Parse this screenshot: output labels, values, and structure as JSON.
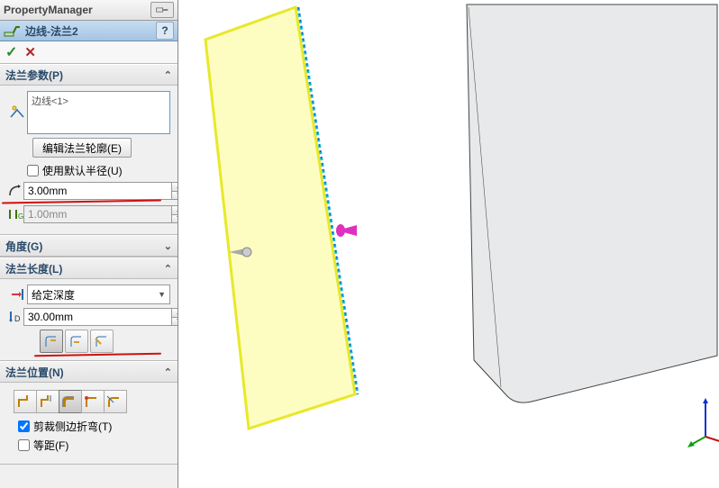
{
  "header": {
    "title": "PropertyManager"
  },
  "command": {
    "title": "边线-法兰2",
    "help": "?"
  },
  "okcancel": {
    "ok": "✓",
    "cancel": "✕"
  },
  "sections": {
    "params": {
      "title": "法兰参数(P)",
      "edge_item": "边线<1>",
      "edit_profile_btn": "编辑法兰轮廓(E)",
      "use_default_radius": "使用默认半径(U)",
      "radius_value": "3.00mm",
      "gap_value": "1.00mm"
    },
    "angle": {
      "title": "角度(G)"
    },
    "length": {
      "title": "法兰长度(L)",
      "depth_type": "给定深度",
      "depth_value": "30.00mm"
    },
    "position": {
      "title": "法兰位置(N)",
      "trim_bends": "剪裁侧边折弯(T)",
      "offset": "等距(F)"
    }
  }
}
